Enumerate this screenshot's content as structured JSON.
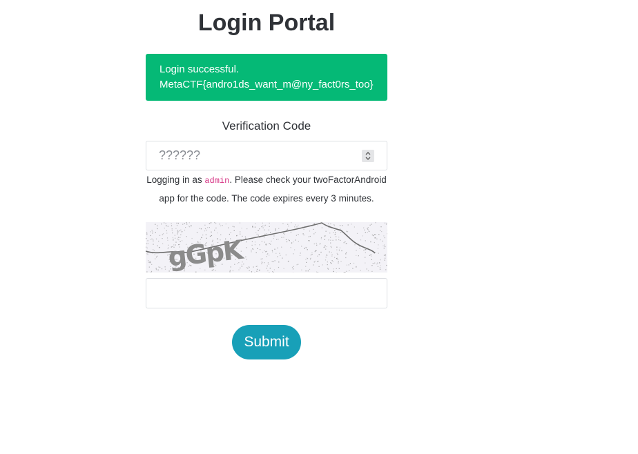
{
  "page": {
    "title": "Login Portal"
  },
  "alert": {
    "line1": "Login successful.",
    "line2": "MetaCTF{andro1ds_want_m@ny_fact0rs_too}",
    "color": "#05b976"
  },
  "verification": {
    "label": "Verification Code",
    "placeholder": "??????",
    "value": ""
  },
  "hint": {
    "prefix": "Logging in as ",
    "username": "admin",
    "suffix": ". Please check your twoFactorAndroid app for the code. The code expires every 3 minutes."
  },
  "captcha": {
    "text": "gGpK",
    "input_value": ""
  },
  "submit": {
    "label": "Submit",
    "color": "#18a0b8"
  },
  "icons": {
    "spinner": "number-stepper-icon"
  }
}
